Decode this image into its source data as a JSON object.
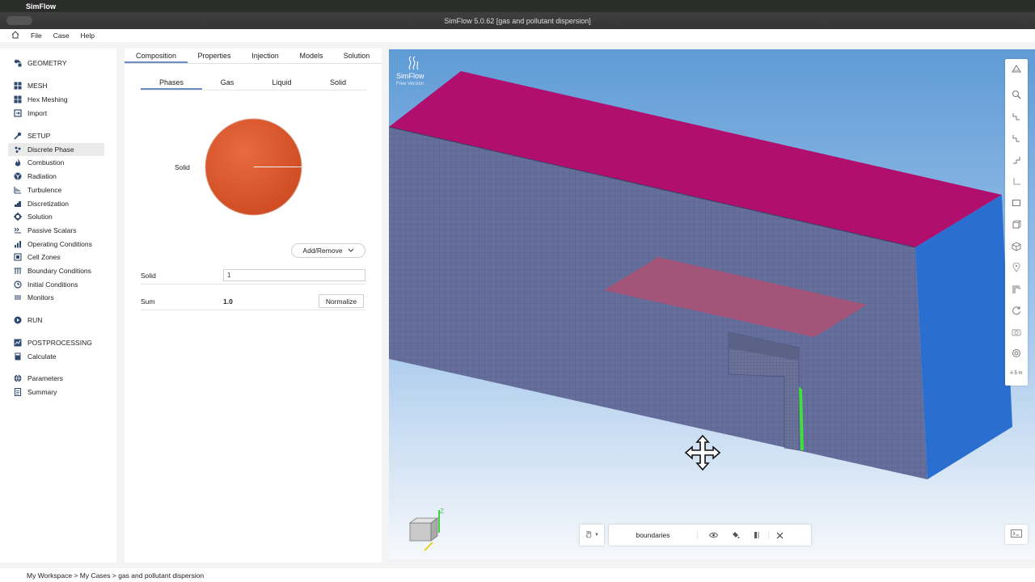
{
  "mac": {
    "app_name": "SimFlow"
  },
  "window": {
    "title": "SimFlow 5.0.62 [gas and pollutant dispersion]"
  },
  "menu": {
    "items": [
      "File",
      "Case",
      "Help"
    ]
  },
  "sidebar": {
    "items": [
      {
        "label": "GEOMETRY",
        "icon": "geometry-icon"
      },
      {
        "label": "MESH",
        "icon": "mesh-icon"
      },
      {
        "label": "Hex Meshing",
        "icon": "hex-meshing-icon"
      },
      {
        "label": "Import",
        "icon": "import-icon"
      },
      {
        "label": "SETUP",
        "icon": "wrench-icon"
      },
      {
        "label": "Discrete Phase",
        "icon": "particles-icon"
      },
      {
        "label": "Combustion",
        "icon": "flame-icon"
      },
      {
        "label": "Radiation",
        "icon": "radiation-icon"
      },
      {
        "label": "Turbulence",
        "icon": "turbulence-icon"
      },
      {
        "label": "Discretization",
        "icon": "discretization-icon"
      },
      {
        "label": "Solution",
        "icon": "gear-icon"
      },
      {
        "label": "Passive Scalars",
        "icon": "passive-scalars-icon"
      },
      {
        "label": "Operating Conditions",
        "icon": "chart-icon"
      },
      {
        "label": "Cell Zones",
        "icon": "cell-zones-icon"
      },
      {
        "label": "Boundary Conditions",
        "icon": "boundary-icon"
      },
      {
        "label": "Initial Conditions",
        "icon": "clock-icon"
      },
      {
        "label": "Monitors",
        "icon": "monitor-icon"
      },
      {
        "label": "RUN",
        "icon": "play-icon"
      },
      {
        "label": "POSTPROCESSING",
        "icon": "postprocessing-icon"
      },
      {
        "label": "Calculate",
        "icon": "calculator-icon"
      },
      {
        "label": "Parameters",
        "icon": "globe-icon"
      },
      {
        "label": "Summary",
        "icon": "document-icon"
      }
    ],
    "active": "Discrete Phase"
  },
  "panel": {
    "tabs": [
      "Composition",
      "Properties",
      "Injection",
      "Models",
      "Solution"
    ],
    "subtabs": [
      "Phases",
      "Gas",
      "Liquid",
      "Solid"
    ],
    "pie": {
      "label": "Solid",
      "color": "#d9532e",
      "fraction": 1.0
    },
    "add_remove_label": "Add/Remove",
    "solid_label": "Solid",
    "solid_value": "1",
    "sum_label": "Sum",
    "sum_value": "1.0",
    "normalize_label": "Normalize"
  },
  "viewport": {
    "logo_title": "SimFlow",
    "logo_subtitle": "Free Version",
    "scale": "# 5 m",
    "visibility_name": "boundaries",
    "colors": {
      "top_face": "#b00f6e",
      "side_face": "#2a6fd0",
      "mesh_face": "#626e9a",
      "highlight": "#3ee03a"
    }
  },
  "footer": {
    "breadcrumb": "My Workspace > My Cases > gas and pollutant dispersion"
  }
}
